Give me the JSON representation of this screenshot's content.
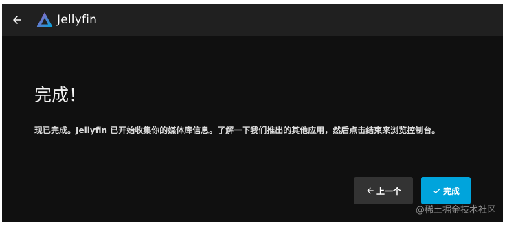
{
  "header": {
    "back_icon": "arrow-left-icon",
    "logo_icon": "jellyfin-logo-icon",
    "logo_text": "Jellyfin"
  },
  "main": {
    "title": "完成！",
    "message": "现已完成。Jellyfin 已开始收集你的媒体库信息。了解一下我们推出的其他应用，然后点击结束来浏览控制台。"
  },
  "buttons": {
    "previous_label": "上一个",
    "previous_icon": "arrow-left-icon",
    "finish_label": "完成",
    "finish_icon": "check-icon"
  },
  "watermark": "@稀土掘金技术社区",
  "colors": {
    "background": "#101010",
    "header": "#202020",
    "accent": "#00a4dc",
    "secondary_button": "#333333"
  }
}
